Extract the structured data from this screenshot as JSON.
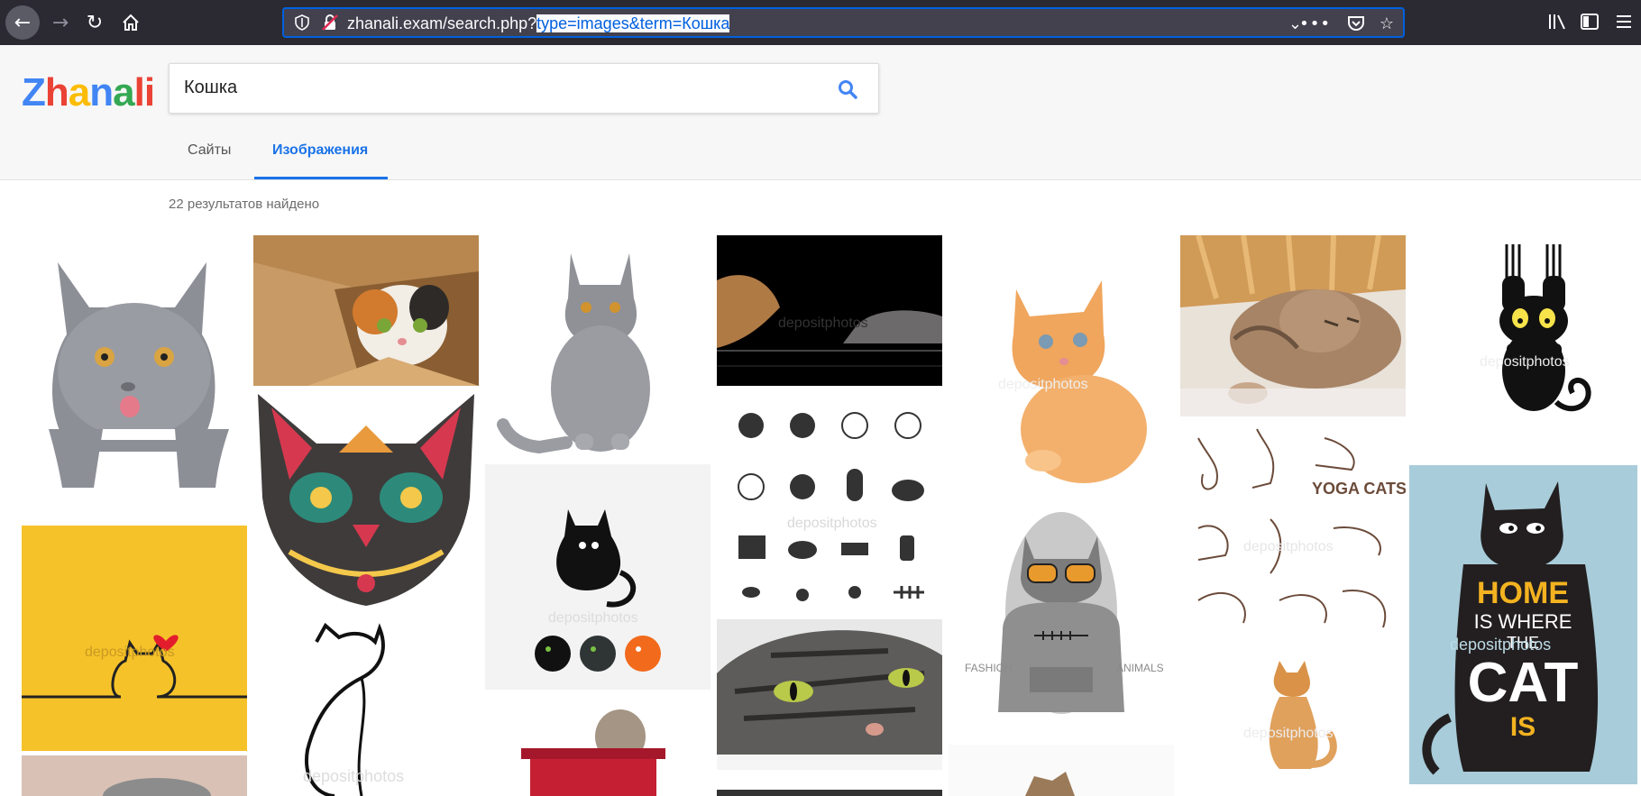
{
  "browser": {
    "url_base": "zhanali.exam/search.php?",
    "url_query": "type=images&term=Кошка"
  },
  "site": {
    "logo_letters": [
      "Z",
      "h",
      "a",
      "n",
      "a",
      "li"
    ]
  },
  "search": {
    "value": "Кошка"
  },
  "tabs": {
    "sites": "Сайты",
    "images": "Изображения"
  },
  "results": {
    "count_text": "22 результатов найдено"
  },
  "images": [
    {
      "subject": "grey british cat with paws over edge",
      "watermark": ""
    },
    {
      "subject": "calico cat in cardboard box",
      "watermark": ""
    },
    {
      "subject": "grey british kitten sitting",
      "watermark": ""
    },
    {
      "subject": "two cats on black background",
      "watermark": "depositphotos"
    },
    {
      "subject": "ginger kitten",
      "watermark": "depositphotos"
    },
    {
      "subject": "sleeping tabby kitten",
      "watermark": ""
    },
    {
      "subject": "black cat hanging by claws",
      "watermark": "depositphotos"
    },
    {
      "subject": "ornamental cat head",
      "watermark": ""
    },
    {
      "subject": "black cat logo with three cats",
      "watermark": "depositphotos"
    },
    {
      "subject": "cat icons set",
      "watermark": "depositphotos"
    },
    {
      "subject": "cat in hoodie with sunglasses",
      "watermark": "FASHION",
      "watermark2": "ANIMALS"
    },
    {
      "subject": "yoga cats sketch",
      "watermark": "depositphotos",
      "text": "YOGA CATS"
    },
    {
      "subject": "home is where the cat is poster",
      "watermark": "depositphotos",
      "text": [
        "HOME",
        "IS WHERE",
        "THE",
        "CAT",
        "IS"
      ]
    },
    {
      "subject": "line cat on yellow with heart",
      "watermark": "depositphotos"
    },
    {
      "subject": "line art cat silhouette",
      "watermark": "depositphotos"
    },
    {
      "subject": "tabby cat close-up green eyes",
      "watermark": ""
    },
    {
      "subject": "ginger cat sitting",
      "watermark": "depositphotos"
    },
    {
      "subject": "kitten in red gift box",
      "watermark": ""
    }
  ],
  "colors": {
    "accent": "#1a73e8",
    "chrome_bg": "#2b2a33",
    "urlbar_bg": "#42414d",
    "urlbar_border": "#0060df"
  }
}
